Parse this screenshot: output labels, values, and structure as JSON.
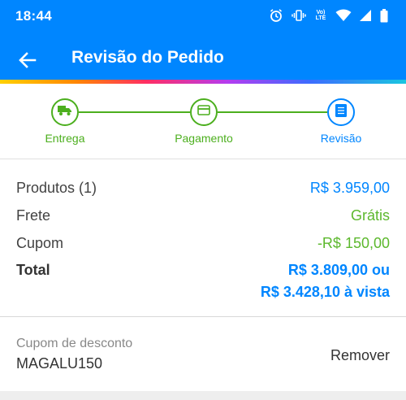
{
  "status_bar": {
    "time": "18:44",
    "network_label_top": "Vo)",
    "network_label_bottom": "LTE",
    "icons": [
      "alarm-icon",
      "vibrate-icon",
      "volte-icon",
      "wifi-icon",
      "signal-icon",
      "battery-icon"
    ]
  },
  "header": {
    "title": "Revisão do Pedido",
    "back_icon": "arrow-left-icon"
  },
  "stepper": {
    "steps": [
      {
        "label": "Entrega",
        "icon": "truck-icon",
        "state": "completed"
      },
      {
        "label": "Pagamento",
        "icon": "card-icon",
        "state": "completed"
      },
      {
        "label": "Revisão",
        "icon": "list-icon",
        "state": "active"
      }
    ]
  },
  "summary": {
    "products_label": "Produtos (1)",
    "products_value": "R$ 3.959,00",
    "shipping_label": "Frete",
    "shipping_value": "Grátis",
    "coupon_label": "Cupom",
    "coupon_value": "-R$ 150,00",
    "total_label": "Total",
    "total_value_line1": "R$ 3.809,00 ou",
    "total_value_line2": "R$ 3.428,10 à vista"
  },
  "coupon": {
    "label": "Cupom de desconto",
    "code": "MAGALU150",
    "remove_label": "Remover"
  },
  "colors": {
    "primary": "#0086ff",
    "success": "#4caf1e",
    "text": "#424242"
  }
}
